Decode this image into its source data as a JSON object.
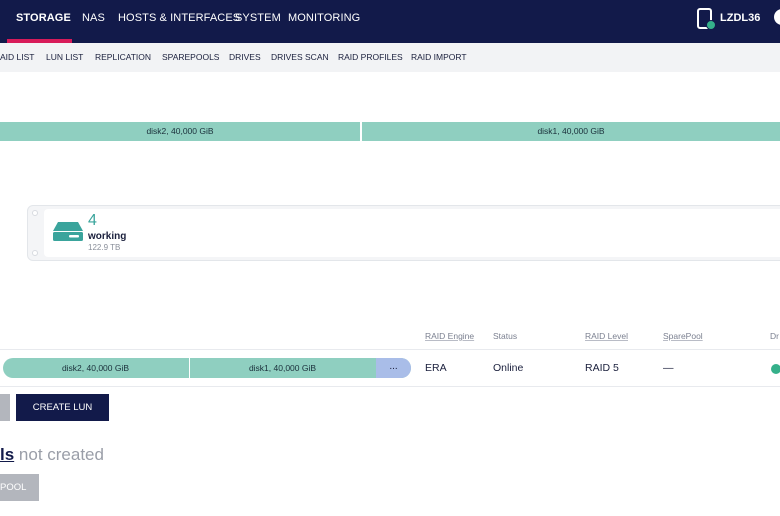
{
  "topnav": {
    "items": [
      "STORAGE",
      "NAS",
      "HOSTS & INTERFACES",
      "SYSTEM",
      "MONITORING"
    ],
    "active": "STORAGE",
    "host": "LZDL36"
  },
  "subnav": {
    "items": [
      "AID LIST",
      "LUN LIST",
      "REPLICATION",
      "SPAREPOOLS",
      "DRIVES",
      "DRIVES SCAN",
      "RAID PROFILES",
      "RAID IMPORT"
    ]
  },
  "disk_overview": {
    "segments": [
      "disk2, 40,000 GiB",
      "disk1, 40,000 GiB"
    ]
  },
  "pool": {
    "count": "4",
    "status": "working",
    "size": "122.9 TB"
  },
  "table": {
    "headers": [
      "RAID Engine",
      "Status",
      "RAID Level",
      "SparePool",
      "Dr"
    ],
    "row": {
      "disks": [
        "disk2, 40,000 GiB",
        "disk1, 40,000 GiB"
      ],
      "more": "...",
      "engine": "ERA",
      "status": "Online",
      "level": "RAID 5",
      "sparepool": "—"
    }
  },
  "buttons": {
    "create_lun": "CREATE LUN",
    "pool": "POOL"
  },
  "pools_message": {
    "lead": "ls",
    "rest": " not created"
  },
  "colors": {
    "nav_bg": "#121a4a",
    "accent": "#d81b5a",
    "disk_seg": "#8fcfc0",
    "ok": "#35b08a"
  }
}
